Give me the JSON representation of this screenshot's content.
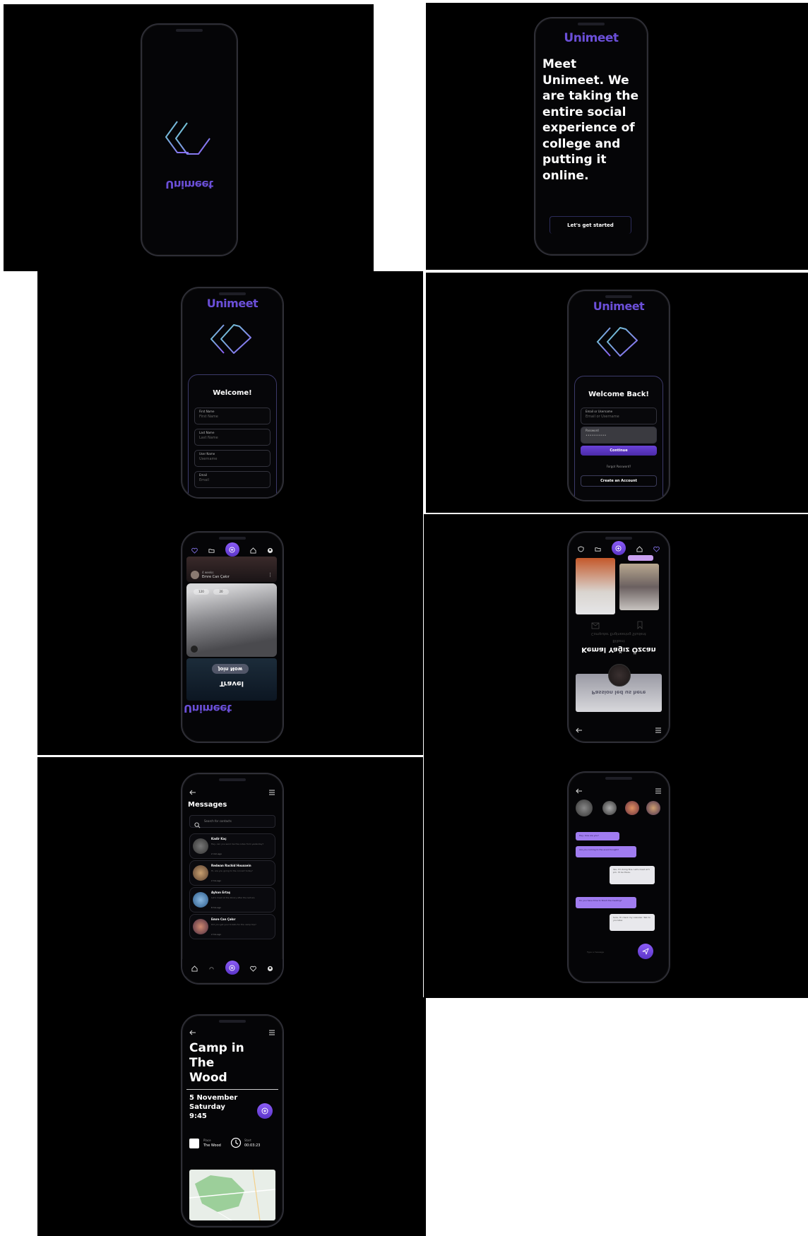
{
  "brand": {
    "name": "Unimeet"
  },
  "colors": {
    "accent": "#6b4fd8",
    "accent_light": "#a07cf0",
    "bg": "#000000"
  },
  "intro": {
    "headline": "Meet Unimeet. We are taking the entire social experience of college and putting it online.",
    "cta": "Let's get started"
  },
  "signup": {
    "title": "Welcome!",
    "fields": [
      {
        "label": "First Name",
        "placeholder": "First Name"
      },
      {
        "label": "Last Name",
        "placeholder": "Last Name"
      },
      {
        "label": "User Name",
        "placeholder": "Username"
      },
      {
        "label": "Email",
        "placeholder": "Email"
      }
    ]
  },
  "login": {
    "title": "Welcome Back!",
    "email_label": "Email or Username",
    "email_placeholder": "Email or Username",
    "password_label": "Password",
    "continue": "Continue",
    "forgot": "Forgot Password?",
    "create": "Create an Account"
  },
  "feed": {
    "post_user": "Emre Can Çakır",
    "post_sub": "4 weeks",
    "stats_1": "120",
    "stats_2": "20",
    "event_title": "Travel",
    "join": "Join Now",
    "brand_bottom": "Unimeet"
  },
  "profile": {
    "name": "Kemal Yağız Özcan",
    "subtitle": "Computer Engineering Student",
    "subtitle2": "Bilkent",
    "banner_text": "Passion led us here"
  },
  "messages": {
    "title": "Messages",
    "search_placeholder": "Search for contacts",
    "items": [
      {
        "name": "Kadir Kaç",
        "preview": "Hey, can you send me the notes from yesterday?",
        "time": "2 min ago"
      },
      {
        "name": "Redwan Rachid Houssein",
        "preview": "Hi, are you going to the concert today?",
        "time": "2 hrs ago"
      },
      {
        "name": "Ayhan Ertaş",
        "preview": "Let's meet at the library after the lecture",
        "time": "8 hrs ago"
      },
      {
        "name": "Emre Can Çakır",
        "preview": "Did you get your tickets for the camp trip?",
        "time": "2 hrs ago"
      }
    ]
  },
  "chat": {
    "bubbles_left": [
      "Hey, how are you?",
      "Are you coming to the event tonight?",
      "Do you have time to finish the meeting?"
    ],
    "bubbles_right": [
      "Yes, I'm doing fine. Let's meet at 5 pm. I'll be there.",
      "Sure, I'll check my calendar. Talk to you later."
    ],
    "input_placeholder": "Type a message"
  },
  "event": {
    "title_l1": "Camp in",
    "title_l2": "The",
    "title_l3": "Wood",
    "date_l1": "5 November",
    "date_l2": "Saturday",
    "date_l3": "9:45",
    "place_label": "Place",
    "place_value": "The Wood",
    "start_label": "Start",
    "start_value": "00:03:23"
  }
}
